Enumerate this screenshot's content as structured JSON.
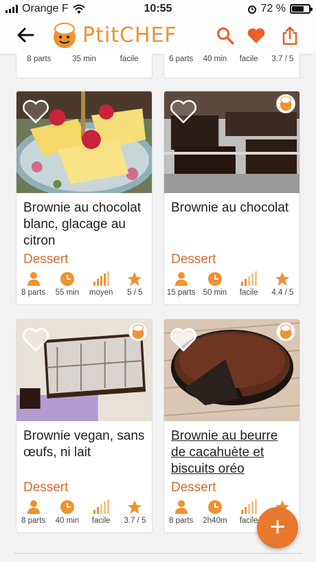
{
  "status": {
    "carrier": "Orange F",
    "time": "10:55",
    "battery": "72 %",
    "battery_level": 0.72
  },
  "appbar": {
    "logo_text": "PtitCHEF"
  },
  "colors": {
    "accent": "#f0922e",
    "category": "#d86b2f",
    "heart": "#e8602c"
  },
  "top_cards": [
    {
      "parts": "8 parts",
      "time": "35 min",
      "level": "facile",
      "rating": ""
    },
    {
      "parts": "6 parts",
      "time": "40 min",
      "level": "facile",
      "rating": "3.7 / 5"
    }
  ],
  "cards": [
    {
      "title": "Brownie au chocolat blanc, glacage au citron",
      "category": "Dessert",
      "parts": "8 parts",
      "time": "55 min",
      "level": "moyen",
      "rating": "5 / 5",
      "image_icon": "lemon-bars-photo"
    },
    {
      "title": "Brownie au chocolat",
      "category": "Dessert",
      "parts": "15 parts",
      "time": "50 min",
      "level": "facile",
      "rating": "4.4 / 5",
      "image_icon": "brownie-squares-photo"
    },
    {
      "title": "Brownie vegan, sans œufs, ni lait",
      "category": "Dessert",
      "parts": "8 parts",
      "time": "40 min",
      "level": "facile",
      "rating": "3.7 / 5",
      "image_icon": "sugared-brownie-photo"
    },
    {
      "title": "Brownie au beurre de cacahuète et biscuits oréo",
      "category": "Dessert",
      "parts": "8 parts",
      "time": "2h40m",
      "level": "facile",
      "rating": "",
      "image_icon": "chocolate-cake-photo"
    }
  ],
  "fab": {
    "label": "+"
  }
}
